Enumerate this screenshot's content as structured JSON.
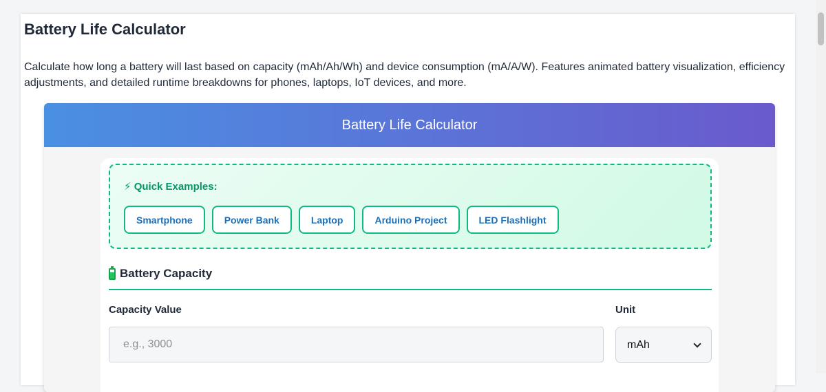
{
  "page": {
    "title": "Battery Life Calculator",
    "description": "Calculate how long a battery will last based on capacity (mAh/Ah/Wh) and device consumption (mA/A/W). Features animated battery visualization, efficiency adjustments, and detailed runtime breakdowns for phones, laptops, IoT devices, and more."
  },
  "calculator": {
    "header_title": "Battery Life Calculator",
    "quick_examples": {
      "title": "⚡ Quick Examples:",
      "buttons": [
        "Smartphone",
        "Power Bank",
        "Laptop",
        "Arduino Project",
        "LED Flashlight"
      ]
    },
    "battery_section": {
      "title": "Battery Capacity",
      "icon": "battery-icon",
      "capacity_label": "Capacity Value",
      "capacity_placeholder": "e.g., 3000",
      "capacity_value": "",
      "unit_label": "Unit",
      "unit_selected": "mAh"
    }
  },
  "colors": {
    "accent_green": "#10b981",
    "header_gradient_start": "#4a90e2",
    "header_gradient_end": "#6a5acd",
    "button_text": "#1d6fb8"
  }
}
